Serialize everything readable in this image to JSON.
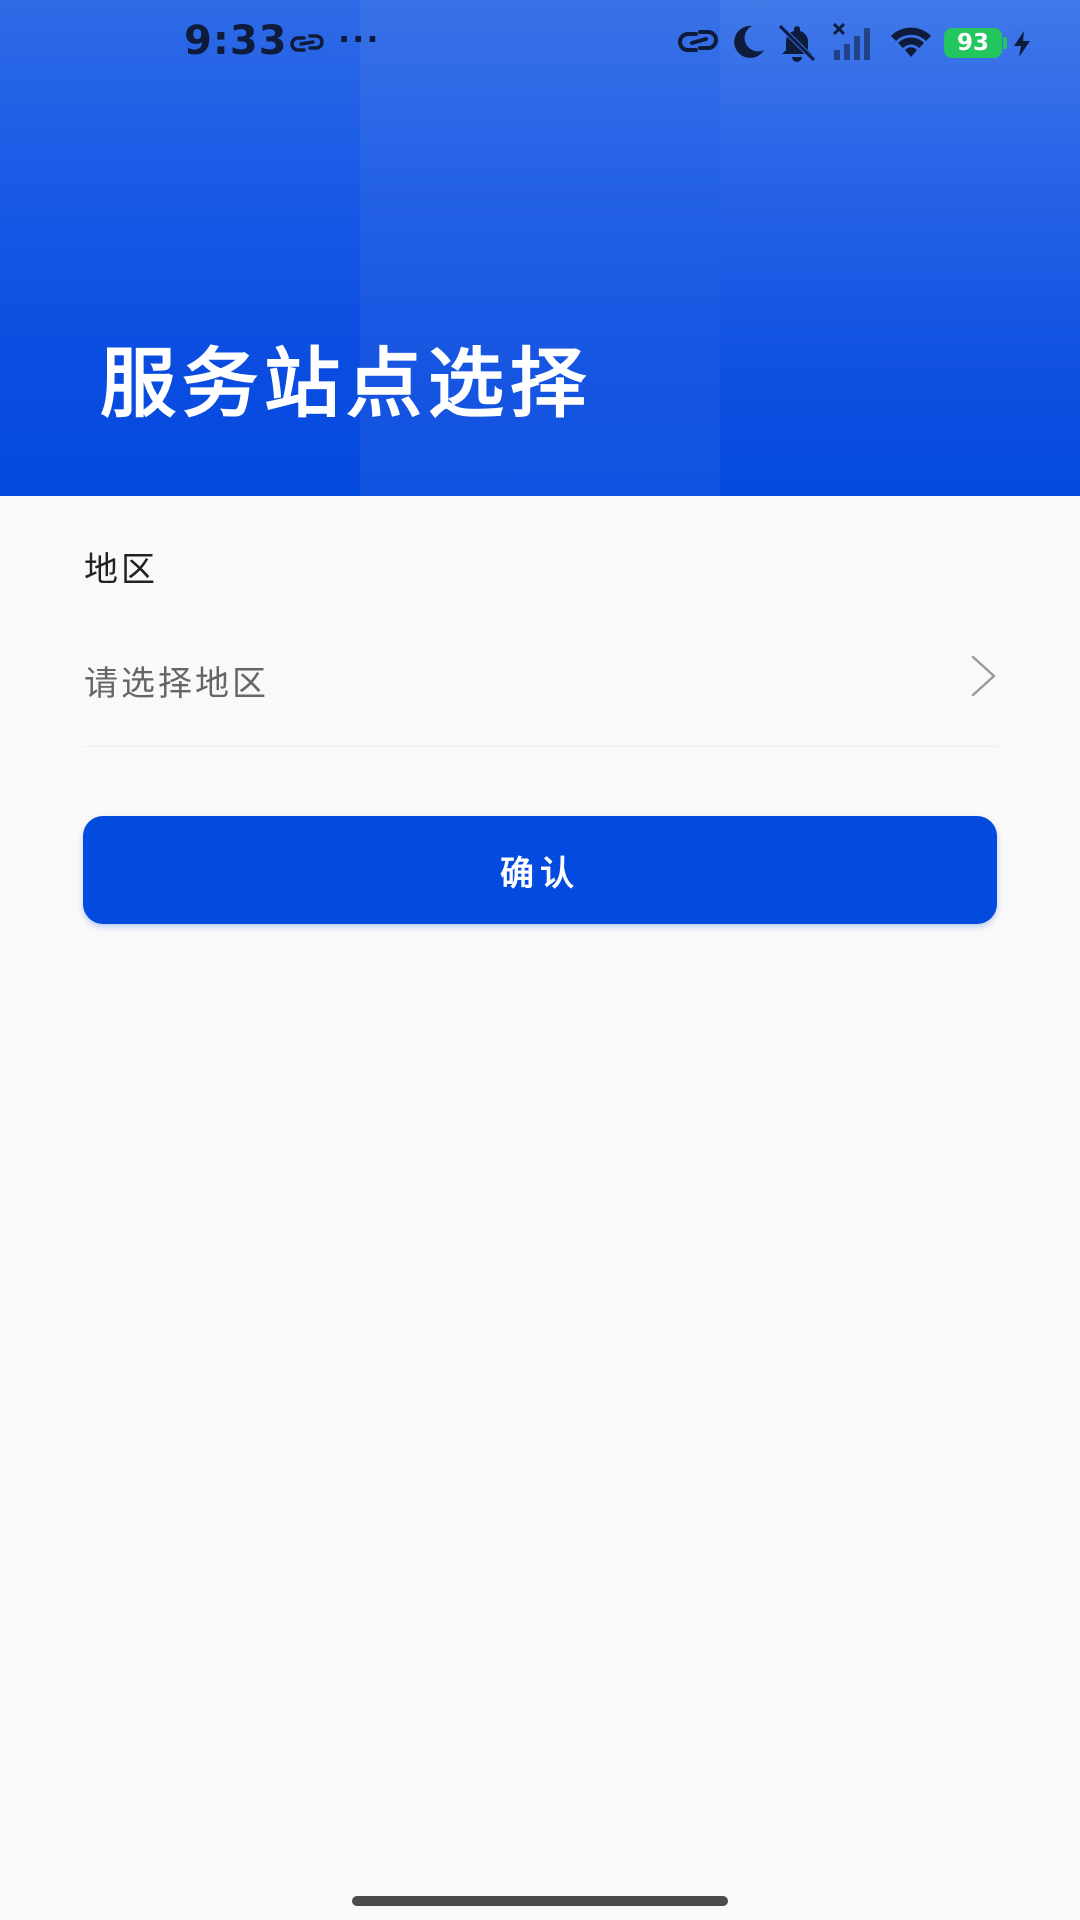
{
  "status_bar": {
    "time": "9:33",
    "more": "···",
    "battery_level": "93",
    "colors": {
      "icons": "#0f1b3a",
      "battery": "#22c55e"
    },
    "icons": [
      "link-icon",
      "more-dots-icon",
      "link-icon",
      "moon-icon",
      "mute-icon",
      "signal-icon",
      "wifi-icon",
      "battery-icon",
      "charging-icon"
    ]
  },
  "header": {
    "title": "服务站点选择",
    "colors": {
      "gradient_top": "#2e6be6",
      "gradient_bottom": "#034adf"
    }
  },
  "form": {
    "region_label": "地区",
    "region_placeholder": "请选择地区"
  },
  "actions": {
    "confirm_label": "确认",
    "accent": "#034adf"
  }
}
